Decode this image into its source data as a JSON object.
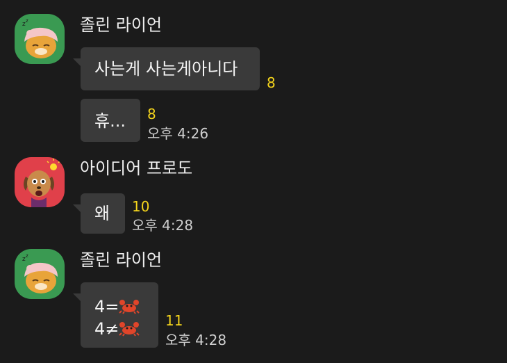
{
  "chat": {
    "groups": [
      {
        "sender": "졸린 라이언",
        "avatar_icon": "sleeping-ryan-icon",
        "avatar_bg": "#3a9a52",
        "messages": [
          {
            "text": "사는게 사는게아니다",
            "unread": "8",
            "time": ""
          },
          {
            "text": "휴...",
            "unread": "8",
            "time": "오후 4:26"
          }
        ]
      },
      {
        "sender": "아이디어 프로도",
        "avatar_icon": "idea-frodo-icon",
        "avatar_bg": "#e0404a",
        "messages": [
          {
            "text": "왜",
            "unread": "10",
            "time": "오후 4:28"
          }
        ]
      },
      {
        "sender": "졸린 라이언",
        "avatar_icon": "sleeping-ryan-icon",
        "avatar_bg": "#3a9a52",
        "messages": [
          {
            "line1_prefix": "4=",
            "line2_prefix": "4≠",
            "emoji_icon": "crab-icon",
            "unread": "11",
            "time": "오후 4:28"
          }
        ]
      }
    ]
  },
  "colors": {
    "background": "#1b1b1b",
    "bubble": "#3a3a3a",
    "unread": "#f5d51c",
    "time": "#d0d0d0"
  }
}
